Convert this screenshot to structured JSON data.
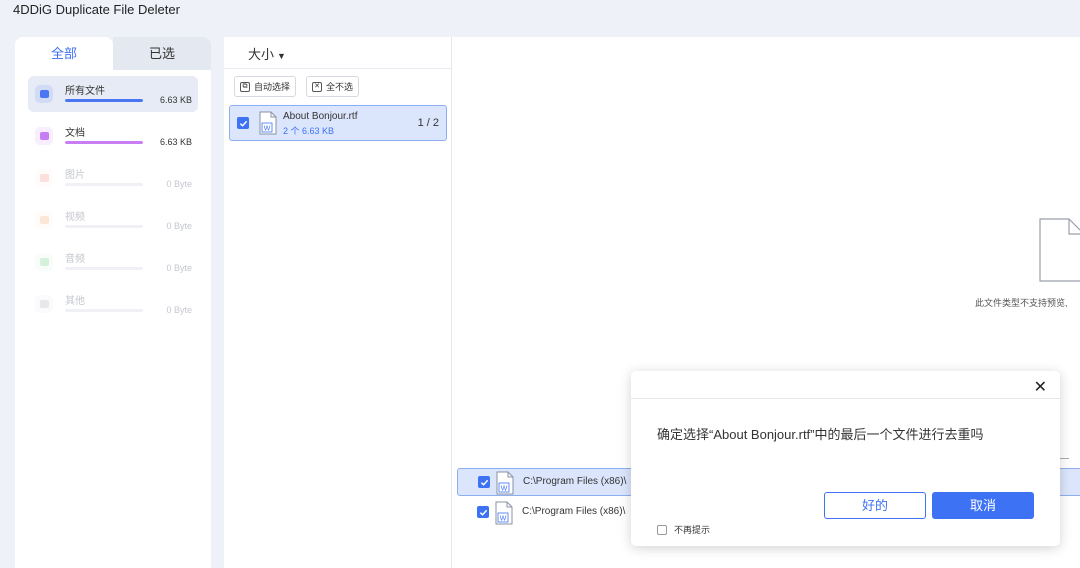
{
  "app": {
    "title": "4DDiG Duplicate File Deleter"
  },
  "colors": {
    "accent": "#3d72f5",
    "page_bg": "#eef1f8"
  },
  "sidebar": {
    "tabs": [
      {
        "label": "全部",
        "active": true
      },
      {
        "label": "已选",
        "active": false
      }
    ],
    "categories": [
      {
        "label": "所有文件",
        "size": "6.63 KB",
        "icon": "folder-icon",
        "color": "#4a76f3",
        "fill": 1.0,
        "active": true
      },
      {
        "label": "文档",
        "size": "6.63 KB",
        "icon": "document-icon",
        "color": "#c97df2",
        "fill": 1.0
      },
      {
        "label": "图片",
        "size": "0 Byte",
        "icon": "image-icon",
        "color": "#f5a99d",
        "fill": 0
      },
      {
        "label": "视频",
        "size": "0 Byte",
        "icon": "video-icon",
        "color": "#f7b88a",
        "fill": 0
      },
      {
        "label": "音频",
        "size": "0 Byte",
        "icon": "audio-icon",
        "color": "#8fd69a",
        "fill": 0
      },
      {
        "label": "其他",
        "size": "0 Byte",
        "icon": "other-icon",
        "color": "#b9bec8",
        "fill": 0
      }
    ]
  },
  "list": {
    "sort_label": "大小",
    "auto_select": "自动选择",
    "deselect_all": "全不选",
    "file": {
      "name": "About Bonjour.rtf",
      "meta": "2 个  6.63 KB",
      "fraction": "1 / 2",
      "checked": true
    }
  },
  "preview": {
    "unsupported_text": "此文件类型不支持预览,",
    "duplicates": [
      {
        "path": "C:\\Program Files (x86)\\",
        "checked": true,
        "selected": true
      },
      {
        "path": "C:\\Program Files (x86)\\",
        "checked": true,
        "selected": false
      }
    ]
  },
  "dialog": {
    "message": "确定选择“About Bonjour.rtf”中的最后一个文件进行去重吗",
    "ok_label": "好的",
    "cancel_label": "取消",
    "dont_show_label": "不再提示",
    "close_symbol": "✕"
  }
}
